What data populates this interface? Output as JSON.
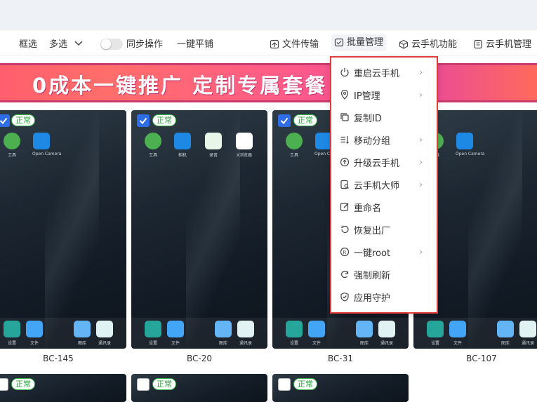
{
  "toolbar": {
    "select_frame": "框选",
    "multi_select": "多选",
    "sync_label": "同步操作",
    "tile_label": "一键平铺",
    "file_transfer": "文件传输",
    "batch_manage": "批量管理",
    "cloud_phone_func": "云手机功能",
    "cloud_phone_manage": "云手机管理"
  },
  "banner": {
    "text": "0成本一键推广 定制专属套餐 %返佣！"
  },
  "status_label": "正常",
  "menu": {
    "items": [
      {
        "label": "重启云手机",
        "icon": "power-icon",
        "has_submenu": true
      },
      {
        "label": "IP管理",
        "icon": "location-icon",
        "has_submenu": true
      },
      {
        "label": "复制ID",
        "icon": "copy-icon",
        "has_submenu": false
      },
      {
        "label": "移动分组",
        "icon": "move-group-icon",
        "has_submenu": true
      },
      {
        "label": "升级云手机",
        "icon": "upgrade-icon",
        "has_submenu": true
      },
      {
        "label": "云手机大师",
        "icon": "master-icon",
        "has_submenu": true
      },
      {
        "label": "重命名",
        "icon": "edit-icon",
        "has_submenu": false
      },
      {
        "label": "恢复出厂",
        "icon": "restore-icon",
        "has_submenu": false
      },
      {
        "label": "一键root",
        "icon": "root-icon",
        "has_submenu": true
      },
      {
        "label": "强制刷新",
        "icon": "refresh-icon",
        "has_submenu": false
      },
      {
        "label": "应用守护",
        "icon": "shield-icon",
        "has_submenu": false
      }
    ]
  },
  "devices": [
    {
      "name": "BC-145",
      "status": "正常",
      "checked": true
    },
    {
      "name": "BC-20",
      "status": "正常",
      "checked": true
    },
    {
      "name": "BC-31",
      "status": "正常",
      "checked": true
    },
    {
      "name": "BC-107",
      "status": "正常",
      "checked": true
    }
  ],
  "apps": {
    "tools": "工具",
    "camera": "相机",
    "recorder": "录音",
    "x_browser": "X浏览器",
    "settings": "设置",
    "files": "文件",
    "gallery": "图库",
    "contacts": "通讯录",
    "opencamera": "Open Camera"
  },
  "colors": {
    "accent": "#2f6de6",
    "status_green": "#39b54a",
    "menu_border": "#e23b3b"
  }
}
